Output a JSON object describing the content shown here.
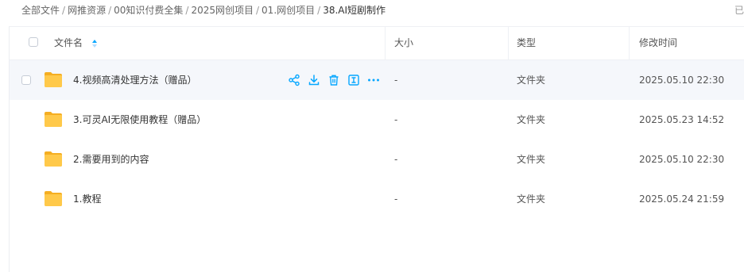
{
  "breadcrumb": {
    "items": [
      "全部文件",
      "网推资源",
      "00知识付费全集",
      "2025网创项目",
      "01.网创项目",
      "38.AI短剧制作"
    ],
    "separator": "/"
  },
  "top_right_text": "已",
  "table": {
    "headers": {
      "name": "文件名",
      "size": "大小",
      "type": "类型",
      "modified": "修改时间"
    },
    "rows": [
      {
        "name": "4.视频高清处理方法（赠品）",
        "size": "-",
        "type": "文件夹",
        "modified": "2025.05.10 22:30",
        "hovered": true
      },
      {
        "name": "3.可灵AI无限使用教程（赠品）",
        "size": "-",
        "type": "文件夹",
        "modified": "2025.05.23 14:52"
      },
      {
        "name": "2.需要用到的内容",
        "size": "-",
        "type": "文件夹",
        "modified": "2025.05.10 22:30"
      },
      {
        "name": "1.教程",
        "size": "-",
        "type": "文件夹",
        "modified": "2025.05.24 21:59"
      }
    ]
  },
  "row_actions": [
    "share-icon",
    "download-icon",
    "delete-icon",
    "rename-icon",
    "more-icon"
  ],
  "colors": {
    "accent": "#06a7ff",
    "folder": "#ffc23b",
    "hover_row": "#f5f7fb"
  }
}
